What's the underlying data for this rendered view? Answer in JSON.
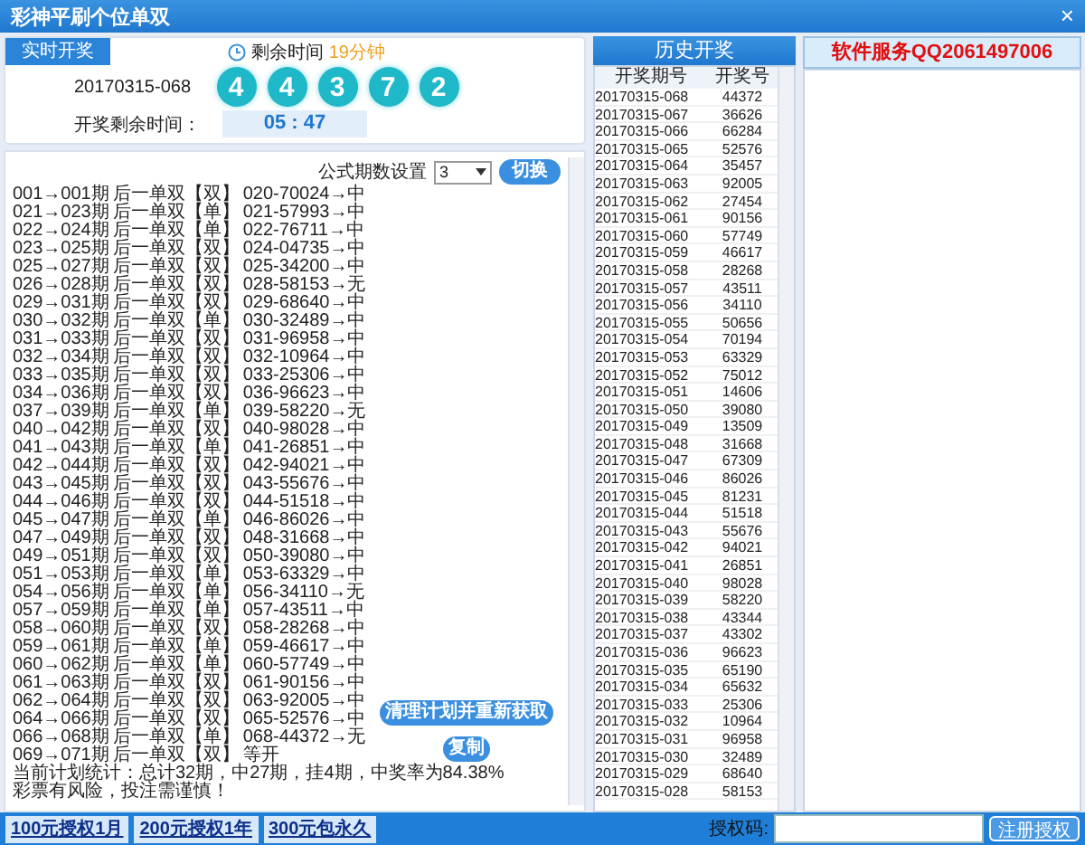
{
  "window": {
    "title": "彩神平刷个位单双",
    "close": "×"
  },
  "live": {
    "tab": {
      "label": "实时开奖",
      "selected": true
    },
    "countdown_label": "剩余时间",
    "countdown_value": "19分钟",
    "period": "20170315-068",
    "balls": [
      "4",
      "4",
      "3",
      "7",
      "2"
    ],
    "timer_label": "开奖剩余时间：",
    "timer_value": "05 : 47"
  },
  "plan": {
    "formula_label": "公式期数设置",
    "formula_value": "3",
    "switch_button": "切换",
    "lines": [
      {
        "range": "001→001期",
        "pick": "后一单双【双】",
        "result": "020-70024→中"
      },
      {
        "range": "021→023期",
        "pick": "后一单双【单】",
        "result": "021-57993→中"
      },
      {
        "range": "022→024期",
        "pick": "后一单双【单】",
        "result": "022-76711→中"
      },
      {
        "range": "023→025期",
        "pick": "后一单双【双】",
        "result": "024-04735→中"
      },
      {
        "range": "025→027期",
        "pick": "后一单双【双】",
        "result": "025-34200→中"
      },
      {
        "range": "026→028期",
        "pick": "后一单双【双】",
        "result": "028-58153→无"
      },
      {
        "range": "029→031期",
        "pick": "后一单双【双】",
        "result": "029-68640→中"
      },
      {
        "range": "030→032期",
        "pick": "后一单双【单】",
        "result": "030-32489→中"
      },
      {
        "range": "031→033期",
        "pick": "后一单双【双】",
        "result": "031-96958→中"
      },
      {
        "range": "032→034期",
        "pick": "后一单双【双】",
        "result": "032-10964→中"
      },
      {
        "range": "033→035期",
        "pick": "后一单双【双】",
        "result": "033-25306→中"
      },
      {
        "range": "034→036期",
        "pick": "后一单双【双】",
        "result": "036-96623→中"
      },
      {
        "range": "037→039期",
        "pick": "后一单双【单】",
        "result": "039-58220→无"
      },
      {
        "range": "040→042期",
        "pick": "后一单双【双】",
        "result": "040-98028→中"
      },
      {
        "range": "041→043期",
        "pick": "后一单双【单】",
        "result": "041-26851→中"
      },
      {
        "range": "042→044期",
        "pick": "后一单双【双】",
        "result": "042-94021→中"
      },
      {
        "range": "043→045期",
        "pick": "后一单双【双】",
        "result": "043-55676→中"
      },
      {
        "range": "044→046期",
        "pick": "后一单双【双】",
        "result": "044-51518→中"
      },
      {
        "range": "045→047期",
        "pick": "后一单双【单】",
        "result": "046-86026→中"
      },
      {
        "range": "047→049期",
        "pick": "后一单双【双】",
        "result": "048-31668→中"
      },
      {
        "range": "049→051期",
        "pick": "后一单双【双】",
        "result": "050-39080→中"
      },
      {
        "range": "051→053期",
        "pick": "后一单双【单】",
        "result": "053-63329→中"
      },
      {
        "range": "054→056期",
        "pick": "后一单双【单】",
        "result": "056-34110→无"
      },
      {
        "range": "057→059期",
        "pick": "后一单双【单】",
        "result": "057-43511→中"
      },
      {
        "range": "058→060期",
        "pick": "后一单双【双】",
        "result": "058-28268→中"
      },
      {
        "range": "059→061期",
        "pick": "后一单双【单】",
        "result": "059-46617→中"
      },
      {
        "range": "060→062期",
        "pick": "后一单双【单】",
        "result": "060-57749→中"
      },
      {
        "range": "061→063期",
        "pick": "后一单双【双】",
        "result": "061-90156→中"
      },
      {
        "range": "062→064期",
        "pick": "后一单双【双】",
        "result": "063-92005→中"
      },
      {
        "range": "064→066期",
        "pick": "后一单双【双】",
        "result": "065-52576→中"
      },
      {
        "range": "066→068期",
        "pick": "后一单双【单】",
        "result": "068-44372→无"
      },
      {
        "range": "069→071期",
        "pick": "后一单双【双】",
        "result": "等开"
      }
    ],
    "stats": [
      "当前计划统计：总计32期，中27期，挂4期，中奖率为84.38%",
      "彩票有风险，投注需谨慎！"
    ],
    "refresh_button": "清理计划并重新获取",
    "copy_button": "复制"
  },
  "history": {
    "title": "历史开奖",
    "columns": [
      "开奖期号",
      "开奖号"
    ],
    "rows": [
      [
        "20170315-068",
        "44372"
      ],
      [
        "20170315-067",
        "36626"
      ],
      [
        "20170315-066",
        "66284"
      ],
      [
        "20170315-065",
        "52576"
      ],
      [
        "20170315-064",
        "35457"
      ],
      [
        "20170315-063",
        "92005"
      ],
      [
        "20170315-062",
        "27454"
      ],
      [
        "20170315-061",
        "90156"
      ],
      [
        "20170315-060",
        "57749"
      ],
      [
        "20170315-059",
        "46617"
      ],
      [
        "20170315-058",
        "28268"
      ],
      [
        "20170315-057",
        "43511"
      ],
      [
        "20170315-056",
        "34110"
      ],
      [
        "20170315-055",
        "50656"
      ],
      [
        "20170315-054",
        "70194"
      ],
      [
        "20170315-053",
        "63329"
      ],
      [
        "20170315-052",
        "75012"
      ],
      [
        "20170315-051",
        "14606"
      ],
      [
        "20170315-050",
        "39080"
      ],
      [
        "20170315-049",
        "13509"
      ],
      [
        "20170315-048",
        "31668"
      ],
      [
        "20170315-047",
        "67309"
      ],
      [
        "20170315-046",
        "86026"
      ],
      [
        "20170315-045",
        "81231"
      ],
      [
        "20170315-044",
        "51518"
      ],
      [
        "20170315-043",
        "55676"
      ],
      [
        "20170315-042",
        "94021"
      ],
      [
        "20170315-041",
        "26851"
      ],
      [
        "20170315-040",
        "98028"
      ],
      [
        "20170315-039",
        "58220"
      ],
      [
        "20170315-038",
        "43344"
      ],
      [
        "20170315-037",
        "43302"
      ],
      [
        "20170315-036",
        "96623"
      ],
      [
        "20170315-035",
        "65190"
      ],
      [
        "20170315-034",
        "65632"
      ],
      [
        "20170315-033",
        "25306"
      ],
      [
        "20170315-032",
        "10964"
      ],
      [
        "20170315-031",
        "96958"
      ],
      [
        "20170315-030",
        "32489"
      ],
      [
        "20170315-029",
        "68640"
      ],
      [
        "20170315-028",
        "58153"
      ]
    ]
  },
  "service": {
    "title": "软件服务QQ2061497006"
  },
  "bottom": {
    "links": [
      "100元授权1月",
      "200元授权1年",
      "300元包永久"
    ],
    "code_label": "授权码:",
    "register_button": "注册授权"
  }
}
